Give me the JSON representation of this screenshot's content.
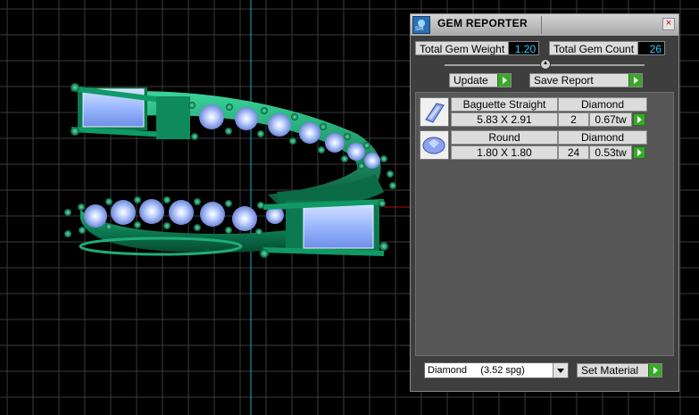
{
  "panel": {
    "title": "GEM REPORTER",
    "close_symbol": "×",
    "logo_text": "SIR",
    "total_gem_weight_label": "Total Gem Weight",
    "total_gem_weight_value": "1.20",
    "total_gem_count_label": "Total Gem Count",
    "total_gem_count_value": "26",
    "update_label": "Update",
    "save_report_label": "Save Report",
    "gems": [
      {
        "shape": "Baguette Straight",
        "material": "Diamond",
        "size": "5.83 X 2.91",
        "count": "2",
        "weight": "0.67tw",
        "icon": "baguette-gem-icon"
      },
      {
        "shape": "Round",
        "material": "Diamond",
        "size": "1.80 X 1.80",
        "count": "24",
        "weight": "0.53tw",
        "icon": "round-gem-icon"
      }
    ],
    "material_select_value": "Diamond     (3.52 spg)",
    "set_material_label": "Set Material"
  },
  "colors": {
    "viewport_bg": "#000000",
    "grid": "#3a3a3a",
    "ring_metal": "#0e7a55",
    "gem": "#a8c4ff",
    "accent_cyan": "#37c6ff",
    "go_green": "#3aa82a"
  }
}
